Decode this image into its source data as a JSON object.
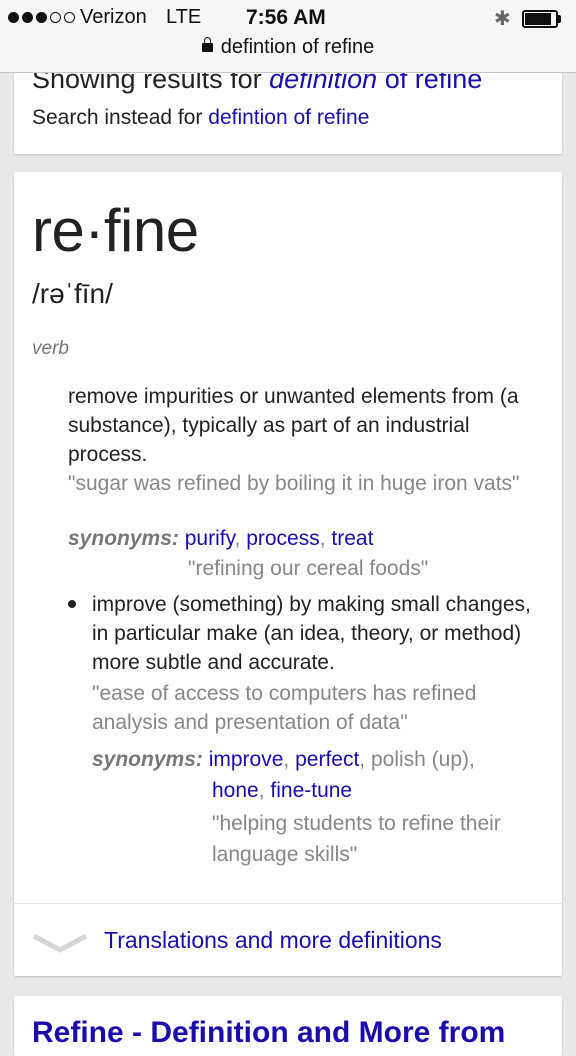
{
  "status_bar": {
    "signal_dots": [
      true,
      true,
      true,
      false,
      false
    ],
    "carrier": "Verizon",
    "network": "LTE",
    "time": "7:56 AM",
    "bluetooth_icon": "bluetooth-icon",
    "battery_level": 0.85
  },
  "url_bar": {
    "lock_icon": "lock-icon",
    "text": "defintion of refine"
  },
  "correction": {
    "prefix": "Showing results for ",
    "query_italic": "definition",
    "query_rest": " of refine",
    "instead_prefix": "Search instead for ",
    "instead_link": "defintion of refine"
  },
  "definition": {
    "word": "re·fine",
    "pronunciation": "/rəˈfīn/",
    "part_of_speech": "verb",
    "senses": [
      {
        "text": "remove impurities or unwanted elements from (a substance), typically as part of an industrial process.",
        "example": "\"sugar was refined by boiling it in huge iron vats\"",
        "synonyms_label": "synonyms:",
        "synonyms": [
          "purify",
          "process",
          "treat"
        ],
        "synonym_example": "\"refining our cereal foods\""
      },
      {
        "text": "improve (something) by making small changes, in particular make (an idea, theory, or method) more subtle and accurate.",
        "example": "\"ease of access to computers has refined analysis and presentation of data\"",
        "synonyms_label": "synonyms:",
        "synonyms": [
          "improve",
          "perfect",
          "polish (up)",
          "hone",
          "fine-tune"
        ],
        "synonym_example": "\"helping students to refine their language skills\""
      }
    ],
    "more_link": "Translations and more definitions"
  },
  "next_result": {
    "title": "Refine - Definition and More from"
  },
  "colors": {
    "link": "#1a0dab",
    "example_gray": "#878787",
    "background": "#e9e9e9"
  }
}
